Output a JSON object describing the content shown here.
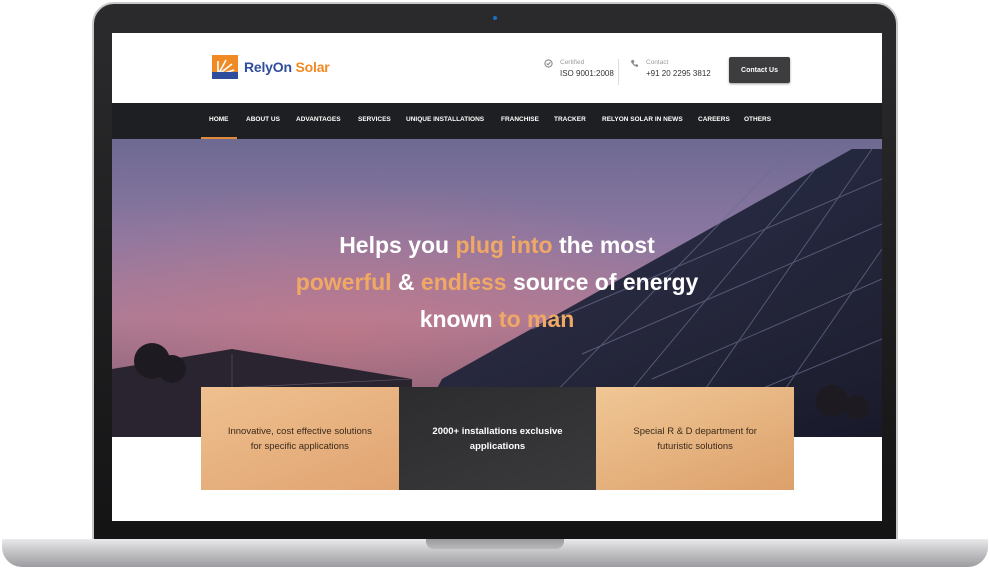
{
  "brand": {
    "name_part1": "RelyOn",
    "name_part2": " Solar",
    "accent": "#f08a24",
    "primary": "#2e4d9b"
  },
  "header": {
    "certified_label": "Certified",
    "certified_value": "ISO 9001:2008",
    "contact_label": "Contact",
    "contact_value": "+91 20 2295 3812",
    "contact_button": "Contact Us"
  },
  "nav": {
    "items": [
      {
        "label": "HOME"
      },
      {
        "label": "ABOUT US"
      },
      {
        "label": "ADVANTAGES"
      },
      {
        "label": "SERVICES"
      },
      {
        "label": "UNIQUE INSTALLATIONS"
      },
      {
        "label": "FRANCHISE"
      },
      {
        "label": "TRACKER"
      },
      {
        "label": "RELYON SOLAR IN NEWS"
      },
      {
        "label": "CAREERS"
      },
      {
        "label": "OTHERS"
      }
    ],
    "active": "HOME"
  },
  "hero": {
    "line1_a": "Helps you ",
    "line1_b": "plug into",
    "line1_c": " the most",
    "line2_a": "powerful",
    "line2_b": " & ",
    "line2_c": "endless",
    "line2_d": " source of energy",
    "line3_a": "known ",
    "line3_b": "to man"
  },
  "features": [
    {
      "line1": "Innovative, cost effective solutions",
      "line2": "for specific applications"
    },
    {
      "line1": "2000+ installations exclusive",
      "line2": "applications"
    },
    {
      "line1": "Special R & D department for",
      "line2": "futuristic solutions"
    }
  ],
  "icons": {
    "certified": "check-circle-icon",
    "contact": "phone-icon",
    "logo": "sun-logo-icon"
  }
}
